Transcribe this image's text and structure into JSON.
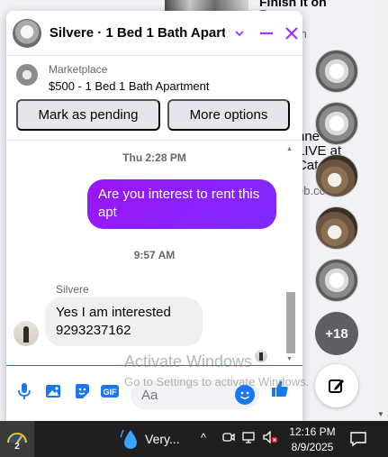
{
  "background": {
    "feed_title": "Finish it on",
    "feed_sub": "F...",
    "feed_sub2": "m",
    "post_title_lines": [
      "nne",
      "LIVE at",
      "Cat"
    ],
    "post_domain": "eb.co"
  },
  "chat": {
    "title": "Silvere · 1 Bed 1 Bath Apart...",
    "listing_label": "Marketplace",
    "listing_title": "$500 - 1 Bed 1 Bath Apartment",
    "mark_pending_label": "Mark as pending",
    "more_options_label": "More options",
    "messages": [
      {
        "type": "timestamp",
        "text": "Thu 2:28 PM"
      },
      {
        "type": "outgoing",
        "text": "Are you interest to rent this apt"
      },
      {
        "type": "timestamp",
        "text": "9:57 AM"
      },
      {
        "type": "incoming",
        "sender": "Silvere",
        "lines": [
          "Yes I am interested",
          "9293237162"
        ]
      }
    ],
    "composer_placeholder": "Aa"
  },
  "bubbles": {
    "more_count": "+18"
  },
  "watermark": {
    "line1": "Activate Windows",
    "line2": "Go to Settings to activate Windows."
  },
  "taskbar": {
    "app_badge": "2",
    "weather_text": "Very...",
    "time": "12:16 PM",
    "date": "8/9/2025"
  },
  "colors": {
    "accent_purple": "#8b0cf7",
    "messenger_blue": "#1877f2",
    "close_purple": "#a033ff"
  }
}
